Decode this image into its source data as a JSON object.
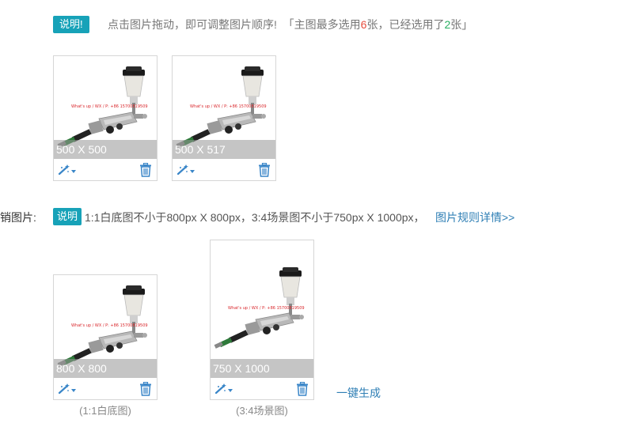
{
  "notice": {
    "badge": "说明!",
    "tip_prefix": "点击图片拖动，即可调整图片顺序!",
    "tip_bracket_open": "「主图最多选用",
    "max_count": "6",
    "tip_mid": "张，已经选用了",
    "used_count": "2",
    "tip_suffix": "张」"
  },
  "main_images": [
    {
      "dimension": "500 X 500",
      "watermark": "What's up / WX / P: +86 15700819509"
    },
    {
      "dimension": "500 X 517",
      "watermark": "What's up / WX / P: +86 15700819509"
    }
  ],
  "marketing": {
    "label": "销图片:",
    "badge": "说明",
    "description": "1:1白底图不小于800px X 800px，3:4场景图不小于750px X 1000px，",
    "rules_link": "图片规则详情>>",
    "images": [
      {
        "dimension": "800 X 800",
        "caption": "(1:1白底图)",
        "watermark": "What's up / WX / P: +86 15700819509"
      },
      {
        "dimension": "750 X 1000",
        "caption": "(3:4场景图)",
        "watermark": "What's up / WX / P: +86 15700819509"
      }
    ],
    "generate_link": "一键生成"
  },
  "icons": {
    "edit": "magic-wand-icon",
    "dropdown": "caret-down-icon",
    "delete": "trash-icon"
  },
  "colors": {
    "accent": "#17a2b8",
    "link": "#2f7fb5",
    "icon": "#3a86c8",
    "red_number": "#e74c3c",
    "green_number": "#27ae60"
  }
}
